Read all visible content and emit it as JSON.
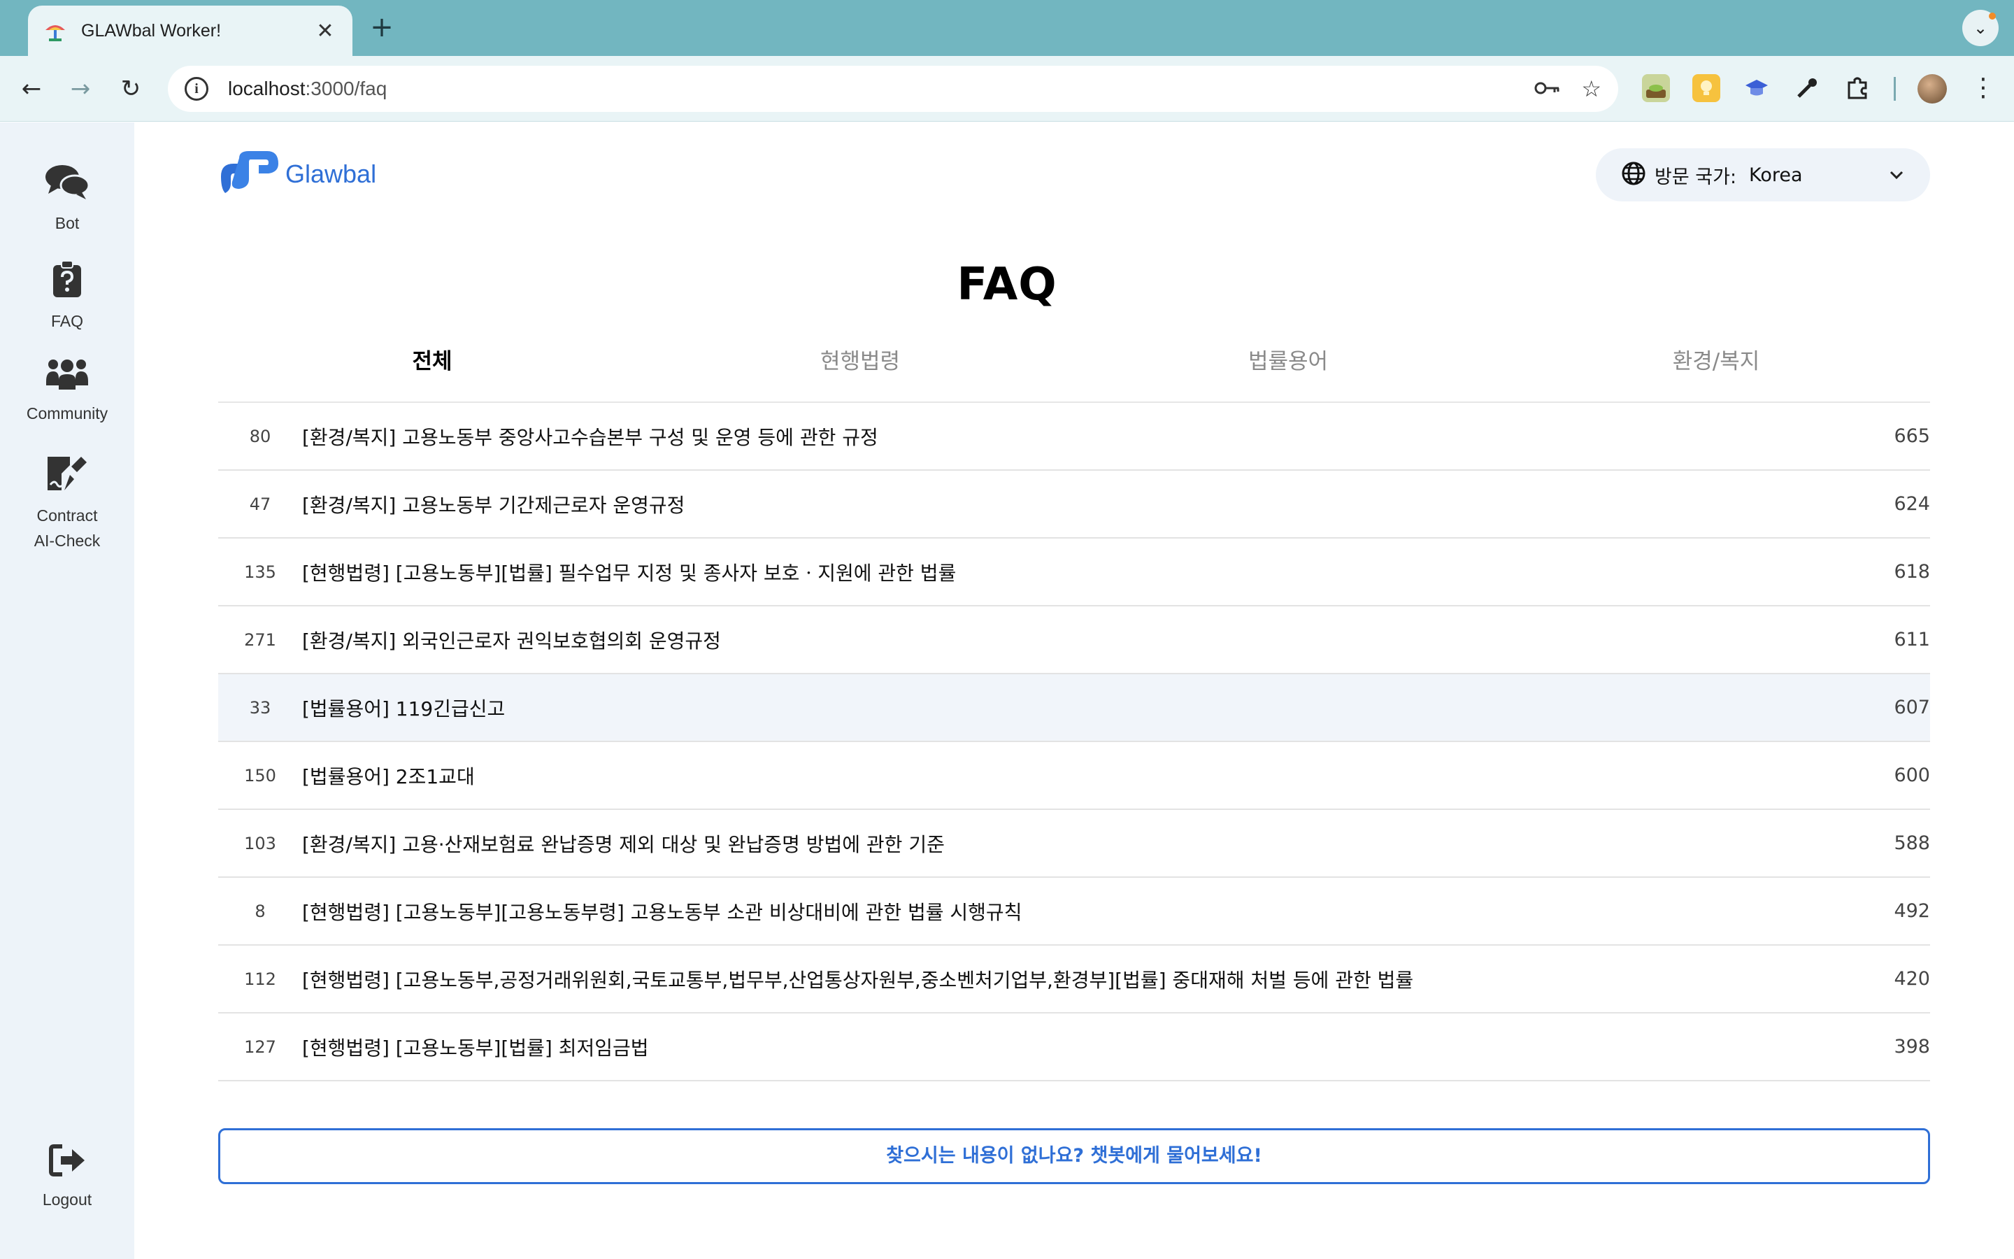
{
  "browser": {
    "tab_title": "GLAWbal Worker!",
    "close_glyph": "✕",
    "new_tab_glyph": "+",
    "url_host": "localhost",
    "url_path": ":3000/faq"
  },
  "sidebar": {
    "items": [
      {
        "label": "Bot",
        "icon": "chat-bubbles-icon"
      },
      {
        "label": "FAQ",
        "icon": "clipboard-question-icon"
      },
      {
        "label": "Community",
        "icon": "people-group-icon"
      },
      {
        "label": "Contract\nAI-Check",
        "icon": "contract-sign-icon"
      }
    ],
    "logout_label": "Logout"
  },
  "header": {
    "logo_text": "Glawbal",
    "country_label": "방문 국가:",
    "country_value": "Korea"
  },
  "page": {
    "title": "FAQ",
    "tabs": [
      {
        "label": "전체",
        "active": true
      },
      {
        "label": "현행법령",
        "active": false
      },
      {
        "label": "법률용어",
        "active": false
      },
      {
        "label": "환경/복지",
        "active": false
      }
    ]
  },
  "faq": [
    {
      "id": "80",
      "title": "[환경/복지] 고용노동부 중앙사고수습본부 구성 및 운영 등에 관한 규정",
      "views": "665"
    },
    {
      "id": "47",
      "title": "[환경/복지] 고용노동부 기간제근로자 운영규정",
      "views": "624"
    },
    {
      "id": "135",
      "title": "[현행법령] [고용노동부][법률] 필수업무 지정 및 종사자 보호ㆍ지원에 관한 법률",
      "views": "618"
    },
    {
      "id": "271",
      "title": "[환경/복지] 외국인근로자 권익보호협의회 운영규정",
      "views": "611"
    },
    {
      "id": "33",
      "title": "[법률용어] 119긴급신고",
      "views": "607"
    },
    {
      "id": "150",
      "title": "[법률용어] 2조1교대",
      "views": "600"
    },
    {
      "id": "103",
      "title": "[환경/복지] 고용·산재보험료 완납증명 제외 대상 및 완납증명 방법에 관한 기준",
      "views": "588"
    },
    {
      "id": "8",
      "title": "[현행법령] [고용노동부][고용노동부령] 고용노동부 소관 비상대비에 관한 법률 시행규칙",
      "views": "492"
    },
    {
      "id": "112",
      "title": "[현행법령] [고용노동부,공정거래위원회,국토교통부,법무부,산업통상자원부,중소벤처기업부,환경부][법률] 중대재해 처벌 등에 관한 법률",
      "views": "420"
    },
    {
      "id": "127",
      "title": "[현행법령] [고용노동부][법률] 최저임금법",
      "views": "398"
    }
  ],
  "ask_bot_label": "찾으시는 내용이 없나요? 챗봇에게 물어보세요!",
  "colors": {
    "accent": "#2f6fd6",
    "browser_frame": "#72b6c0",
    "sidebar_bg": "#edf3f9",
    "hover_row": "#f1f5fa"
  }
}
